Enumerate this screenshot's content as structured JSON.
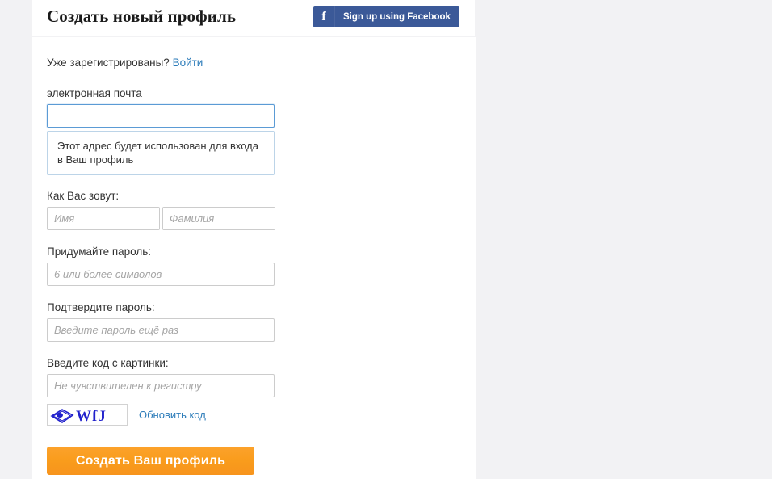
{
  "header": {
    "title": "Создать новый профиль",
    "facebook_button": {
      "icon": "facebook-f-icon",
      "label": "Sign up using Facebook",
      "color": "#3b5998"
    }
  },
  "form": {
    "login_prompt": "Уже зарегистрированы?",
    "login_link": "Войти",
    "email": {
      "label": "электронная почта",
      "value": "",
      "placeholder": "",
      "focused": true,
      "hint": "Этот адрес будет использован для входа в Ваш профиль"
    },
    "name": {
      "label": "Как Вас зовут:",
      "first_placeholder": "Имя",
      "first_value": "",
      "last_placeholder": "Фамилия",
      "last_value": ""
    },
    "password": {
      "label": "Придумайте пароль:",
      "placeholder": "6 или более символов",
      "value": ""
    },
    "password_confirm": {
      "label": "Подтвердите пароль:",
      "placeholder": "Введите пароль ещё раз",
      "value": ""
    },
    "captcha": {
      "label": "Введите код с картинки:",
      "placeholder": "Не чувствителен к регистру",
      "value": "",
      "image_text": "WfJ",
      "image_color": "#2020cc",
      "refresh_label": "Обновить код"
    },
    "submit_label": "Создать Ваш профиль",
    "submit_color": "#f7941d"
  },
  "colors": {
    "link": "#2b7bb9",
    "page_background": "#f2f2f4",
    "panel_background": "#ffffff",
    "input_border": "#cccccc",
    "focus_border": "#5b9bd5",
    "hint_border": "#bcd4e8"
  }
}
